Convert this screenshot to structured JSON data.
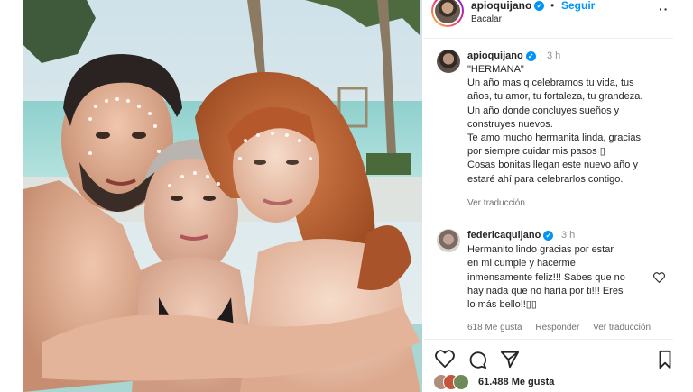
{
  "post": {
    "username": "apioquijano",
    "separator": "•",
    "follow_label": "Seguir",
    "location": "Bacalar",
    "more_icon": "more-horizontal-icon"
  },
  "caption": {
    "username": "apioquijano",
    "time": "3 h",
    "lines": [
      "\"HERMANA\"",
      "Un año mas q celebramos tu vida, tus",
      "años, tu amor, tu fortaleza, tu grandeza.",
      "Un año donde concluyes sueños y",
      "construyes nuevos.",
      "Te amo mucho hermanita linda, gracias",
      "por siempre cuidar mis pasos ▯",
      "Cosas bonitas llegan este nuevo año y",
      "estaré ahí para celebrarlos contigo."
    ],
    "translate_label": "Ver traducción"
  },
  "comment": {
    "username": "federicaquijano",
    "time": "3 h",
    "lines": [
      "Hermanito lindo gracias por estar",
      "en mi cumple y hacerme",
      "inmensamente feliz!!! Sabes que no",
      "hay nada que no haría por ti!!! Eres",
      "lo más bello!!▯▯"
    ],
    "likes": "618 Me gusta",
    "reply_label": "Responder",
    "translate_label": "Ver traducción"
  },
  "footer": {
    "likes_count": "61.488 Me gusta"
  },
  "colors": {
    "accent": "#0095f6",
    "secondary_text": "#737373"
  }
}
